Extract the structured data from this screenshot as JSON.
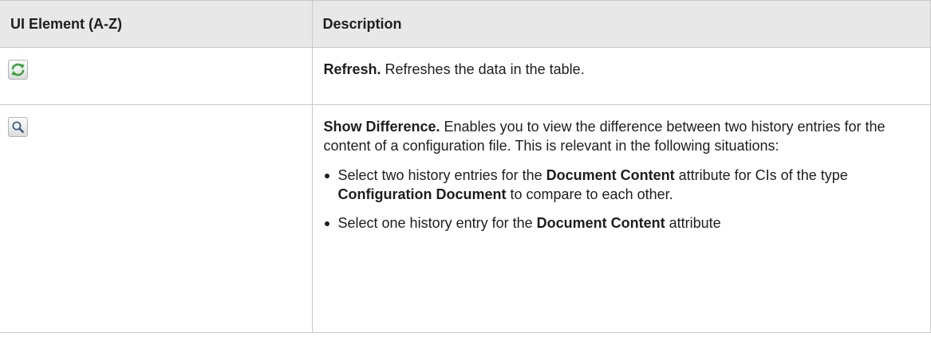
{
  "table": {
    "headers": {
      "element": "UI Element (A-Z)",
      "description": "Description"
    },
    "rows": [
      {
        "icon": "refresh-icon",
        "title": "Refresh.",
        "text": " Refreshes the data in the table."
      },
      {
        "icon": "magnifier-icon",
        "title": "Show Difference.",
        "text": " Enables you to view the difference between two history entries for the content of a configuration file. This is relevant in the following situations:",
        "bullets": [
          {
            "t1": "Select two history entries for the ",
            "b1": "Document Content",
            "t2": " attribute for CIs of the type ",
            "b2": "Configuration Document",
            "t3": " to compare to each other."
          },
          {
            "t1": "Select one history entry for the ",
            "b1": "Document Content",
            "t2": " attribute"
          }
        ]
      }
    ]
  },
  "colors": {
    "header_bg": "#e8e8e8",
    "border": "#c8c8c8",
    "refresh_green": "#3aa33a"
  }
}
